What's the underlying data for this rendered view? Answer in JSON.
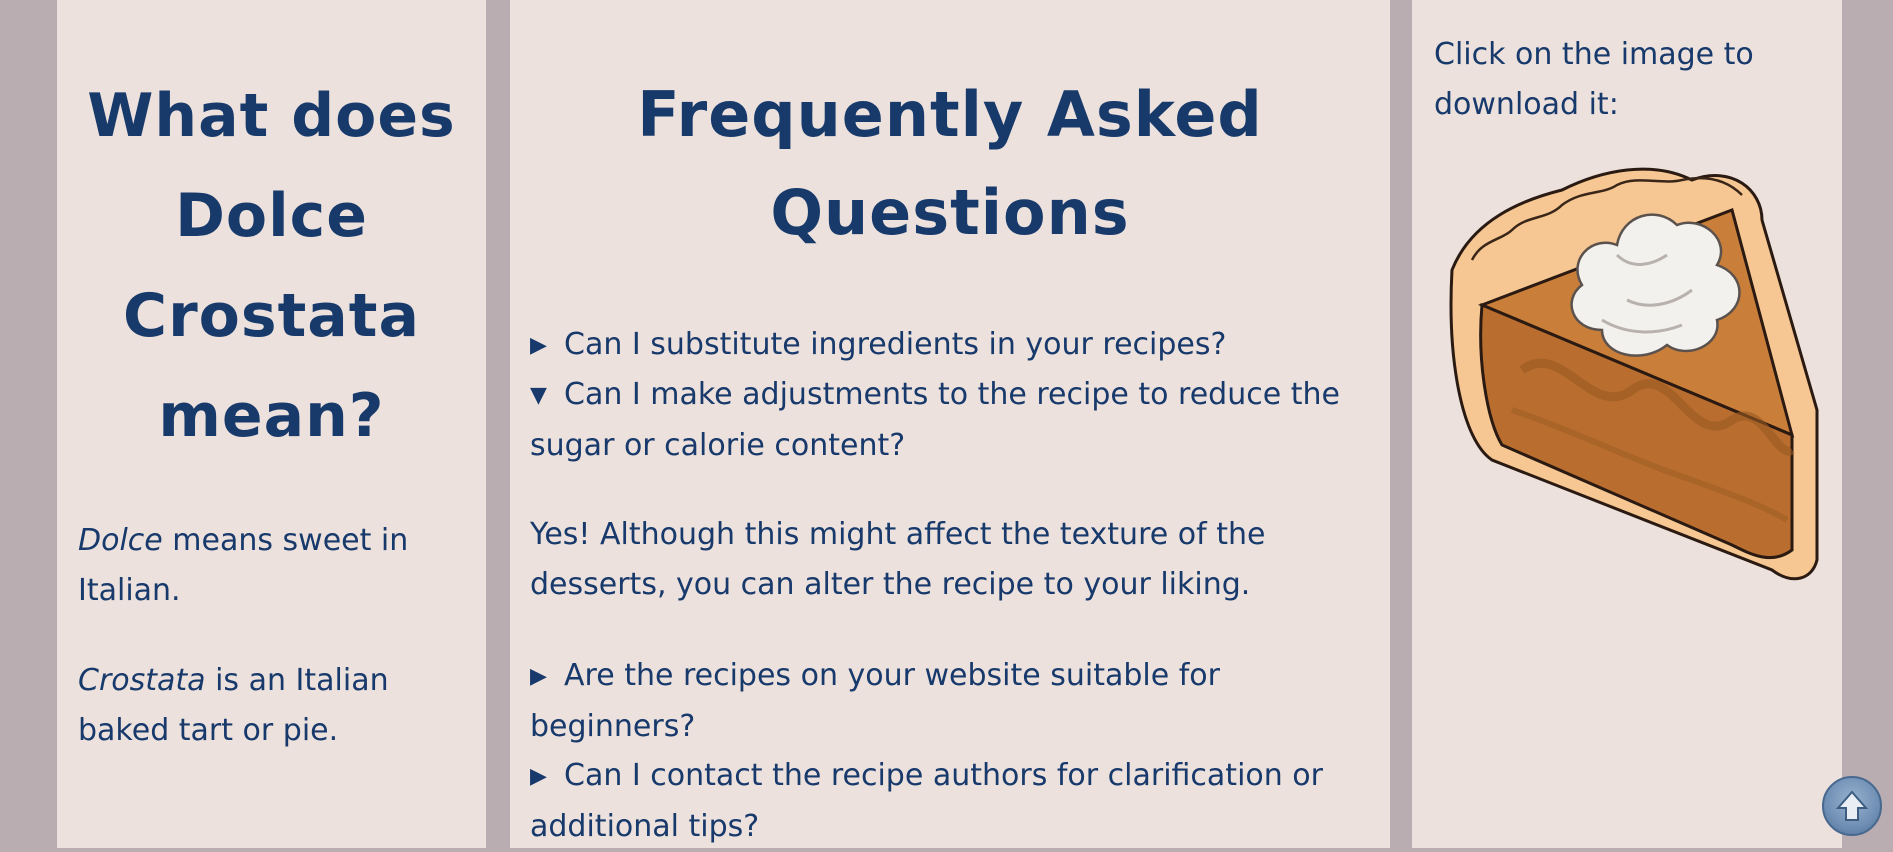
{
  "left": {
    "title": "What does Dolce Crostata mean?",
    "def1_term": "Dolce",
    "def1_rest": " means sweet in Italian.",
    "def2_term": "Crostata",
    "def2_rest": " is an Italian baked tart or pie."
  },
  "faq": {
    "title": "Frequently Asked Questions",
    "items": [
      {
        "question": "Can I substitute ingredients in your recipes?",
        "open": false
      },
      {
        "question": "Can I make adjustments to the recipe to reduce the sugar or calorie content?",
        "open": true,
        "answer": "Yes! Although this might affect the texture of the desserts, you can alter the recipe to your liking."
      },
      {
        "question": "Are the recipes on your website suitable for beginners?",
        "open": false
      },
      {
        "question": "Can I contact the recipe authors for clarification or additional tips?",
        "open": false
      }
    ],
    "closed_marker": "▶",
    "open_marker": "▼"
  },
  "right": {
    "instruction": "Click on the image to download it:",
    "image_icon": "pumpkin-pie-slice-illustration"
  },
  "back_to_top_icon": "arrow-up-icon",
  "colors": {
    "background": "#b9adb1",
    "panel": "#ece1dc",
    "text": "#17396b"
  }
}
